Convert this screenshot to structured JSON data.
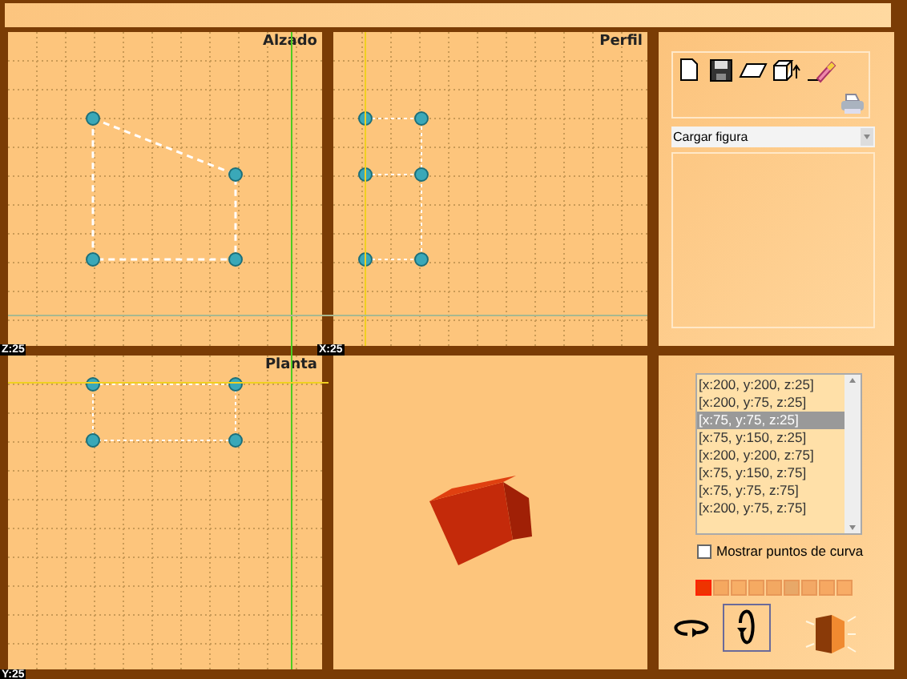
{
  "views": [
    {
      "title": "Alzado",
      "kind": "alzado"
    },
    {
      "title": "Perfil",
      "kind": "perfil"
    },
    {
      "title": "Planta",
      "kind": "planta"
    }
  ],
  "sliders": [
    {
      "label": "Z:25"
    },
    {
      "label": "X:25"
    },
    {
      "label": "Y:25"
    }
  ],
  "toolbar": {
    "dropdown": {
      "value": "Cargar figura"
    }
  },
  "points_list": [
    {
      "label": "[x:200, y:200, z:25]",
      "selected": false
    },
    {
      "label": "[x:200, y:75, z:25]",
      "selected": false
    },
    {
      "label": "[x:75, y:75, z:25]",
      "selected": true
    },
    {
      "label": "[x:75, y:150, z:25]",
      "selected": false
    },
    {
      "label": "[x:200, y:200, z:75]",
      "selected": false
    },
    {
      "label": "[x:75, y:150, z:75]",
      "selected": false
    },
    {
      "label": "[x:75, y:75, z:75]",
      "selected": false
    },
    {
      "label": "[x:200, y:75, z:75]",
      "selected": false
    }
  ],
  "show_curve_points": {
    "label": "Mostrar puntos de curva",
    "checked": false
  },
  "swatches": [
    {
      "color": "#ee3300",
      "selected": true
    },
    {
      "color": "#f5a860",
      "selected": false
    },
    {
      "color": "#f7ae66",
      "selected": false
    },
    {
      "color": "#f5aa62",
      "selected": false
    },
    {
      "color": "#f2a862",
      "selected": false
    },
    {
      "color": "#e8a868",
      "selected": false
    },
    {
      "color": "#f3a865",
      "selected": false
    },
    {
      "color": "#f6a862",
      "selected": false
    },
    {
      "color": "#f8ac66",
      "selected": false
    }
  ],
  "rotate_modes": [
    {
      "kind": "horizontal",
      "selected": false
    },
    {
      "kind": "vertical",
      "selected": true
    }
  ]
}
